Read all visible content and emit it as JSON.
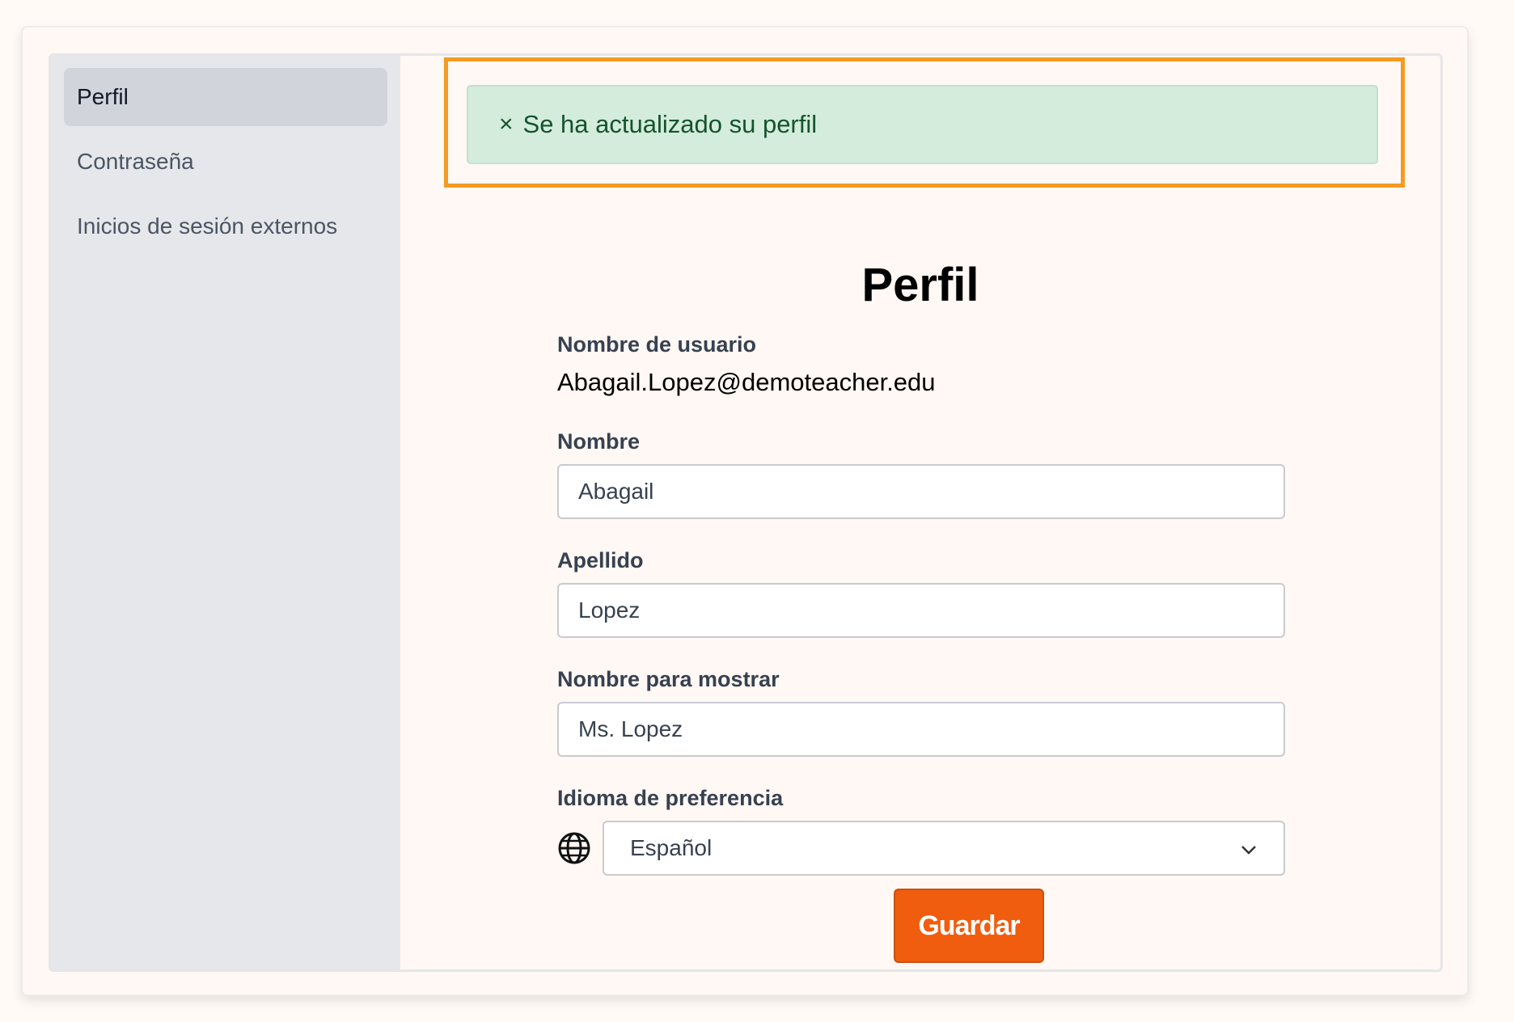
{
  "sidebar": {
    "items": [
      {
        "label": "Perfil",
        "active": true
      },
      {
        "label": "Contraseña",
        "active": false
      },
      {
        "label": "Inicios de sesión externos",
        "active": false
      }
    ]
  },
  "alert": {
    "close": "×",
    "message": "Se ha actualizado su perfil",
    "color": "#14532d",
    "highlight_color": "#f59a23"
  },
  "page": {
    "title": "Perfil"
  },
  "form": {
    "username_label": "Nombre de usuario",
    "username_value": "Abagail.Lopez@demoteacher.edu",
    "first_name_label": "Nombre",
    "first_name_value": "Abagail",
    "last_name_label": "Apellido",
    "last_name_value": "Lopez",
    "display_name_label": "Nombre para mostrar",
    "display_name_value": "Ms. Lopez",
    "language_label": "Idioma de preferencia",
    "language_value": "Español",
    "language_icon": "globe-icon",
    "save_label": "Guardar",
    "save_color": "#f05d0e"
  }
}
